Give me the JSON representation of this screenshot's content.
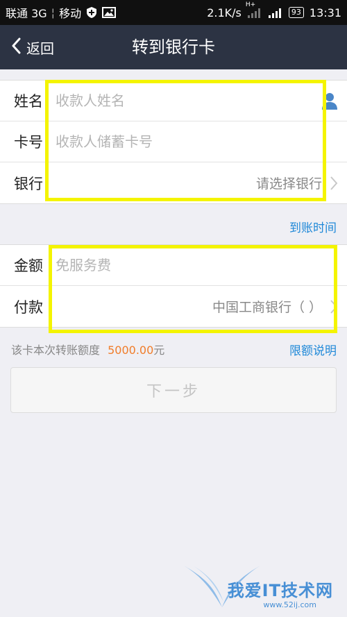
{
  "status_bar": {
    "carrier1": "联通 3G",
    "carrier2": "移动",
    "speed": "2.1K/s",
    "network_type": "H+",
    "battery": "93",
    "time": "13:31"
  },
  "nav": {
    "back_label": "返回",
    "title": "转到银行卡"
  },
  "recipient_form": {
    "name_label": "姓名",
    "name_placeholder": "收款人姓名",
    "card_label": "卡号",
    "card_placeholder": "收款人储蓄卡号",
    "bank_label": "银行",
    "bank_value": "请选择银行"
  },
  "arrival_time_link": "到账时间",
  "payment_form": {
    "amount_label": "金额",
    "amount_placeholder": "免服务费",
    "pay_label": "付款",
    "pay_value": "中国工商银行（        ）"
  },
  "limit": {
    "text_prefix": "该卡本次转账额度",
    "amount": "5000.00",
    "unit": "元",
    "info_link": "限额说明"
  },
  "next_button": "下一步",
  "watermark": {
    "text": "我爱IT技术网",
    "sub": "www.52ij.com"
  },
  "colors": {
    "nav_bg": "#2c3343",
    "link": "#1e88d8",
    "amount": "#f07d2a",
    "highlight": "#f4f400"
  }
}
